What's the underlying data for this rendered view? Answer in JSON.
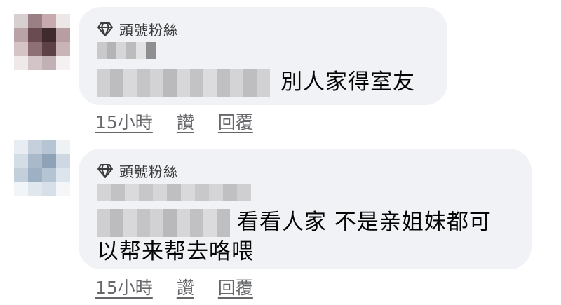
{
  "comments": [
    {
      "badge": "頭號粉絲",
      "text_line1": "別人家得室友",
      "text_line2": "",
      "actions": {
        "time": "15小時",
        "like": "讚",
        "reply": "回覆"
      }
    },
    {
      "badge": "頭號粉絲",
      "text_line1": "看看人家 不是亲姐妹都可",
      "text_line2": "以帮来帮去咯喂",
      "actions": {
        "time": "15小時",
        "like": "讚",
        "reply": "回覆"
      }
    }
  ],
  "colors": {
    "bubble": "#f0f2f5",
    "meta_text": "#65676b",
    "badge_text": "#3a3b3c"
  },
  "icons": {
    "badge": "diamond-icon"
  }
}
